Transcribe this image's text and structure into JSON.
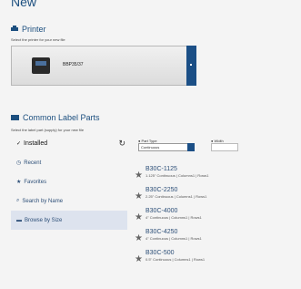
{
  "window": {
    "title": "New"
  },
  "printer": {
    "heading": "Printer",
    "hint": "Select the printer for your new file",
    "selected_name": "BBP35/37",
    "icon": "printer-icon"
  },
  "label_parts": {
    "heading": "Common Label Parts",
    "hint": "Select the label part (supply) for your new file",
    "icon": "label-stack-icon"
  },
  "nav": {
    "installed": "Installed",
    "recent": "Recent",
    "favorites": "Favorites",
    "search_by_name": "Search by Name",
    "browse_by_size": "Browse by Size"
  },
  "filters": {
    "part_type_label": "Part Type",
    "part_type_value": "Continuous",
    "width_label": "Width"
  },
  "results": [
    {
      "name": "B30C-1125",
      "desc": "1.125\" Continuous  |  Columns1  |  Rows1"
    },
    {
      "name": "B30C-2250",
      "desc": "2.25\" Continuous  |  Columns1  |  Rows1"
    },
    {
      "name": "B30C-4000",
      "desc": "4\" Continuous  |  Columns1  |  Rows1"
    },
    {
      "name": "B30C-4250",
      "desc": "4\" Continuous  |  Columns1  |  Rows1"
    },
    {
      "name": "B30C-500",
      "desc": "0.5\" Continuous  |  Columns1  |  Rows1"
    }
  ]
}
